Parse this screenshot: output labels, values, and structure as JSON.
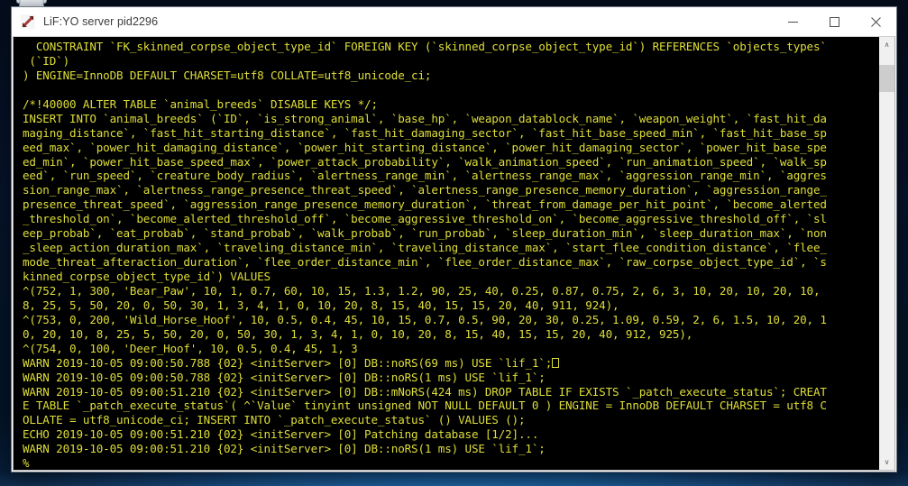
{
  "window": {
    "title": "LiF:YO server pid2296",
    "app_icon": "lif-yo-server-icon",
    "minimize_label": "Minimize",
    "maximize_label": "Maximize",
    "close_label": "Close"
  },
  "scrollbar": {
    "up_arrow": "∧",
    "down_arrow": "∨"
  },
  "console": {
    "prompt": "%",
    "lines": [
      "  CONSTRAINT `FK_skinned_corpse_object_type_id` FOREIGN KEY (`skinned_corpse_object_type_id`) REFERENCES `objects_types`",
      " (`ID`)",
      ") ENGINE=InnoDB DEFAULT CHARSET=utf8 COLLATE=utf8_unicode_ci;",
      "",
      "/*!40000 ALTER TABLE `animal_breeds` DISABLE KEYS */;",
      "INSERT INTO `animal_breeds` (`ID`, `is_strong_animal`, `base_hp`, `weapon_datablock_name`, `weapon_weight`, `fast_hit_da",
      "maging_distance`, `fast_hit_starting_distance`, `fast_hit_damaging_sector`, `fast_hit_base_speed_min`, `fast_hit_base_sp",
      "eed_max`, `power_hit_damaging_distance`, `power_hit_starting_distance`, `power_hit_damaging_sector`, `power_hit_base_spe",
      "ed_min`, `power_hit_base_speed_max`, `power_attack_probability`, `walk_animation_speed`, `run_animation_speed`, `walk_sp",
      "eed`, `run_speed`, `creature_body_radius`, `alertness_range_min`, `alertness_range_max`, `aggression_range_min`, `aggres",
      "sion_range_max`, `alertness_range_presence_threat_speed`, `alertness_range_presence_memory_duration`, `aggression_range_",
      "presence_threat_speed`, `aggression_range_presence_memory_duration`, `threat_from_damage_per_hit_point`, `become_alerted",
      "_threshold_on`, `become_alerted_threshold_off`, `become_aggressive_threshold_on`, `become_aggressive_threshold_off`, `sl",
      "eep_probab`, `eat_probab`, `stand_probab`, `walk_probab`, `run_probab`, `sleep_duration_min`, `sleep_duration_max`, `non",
      "_sleep_action_duration_max`, `traveling_distance_min`, `traveling_distance_max`, `start_flee_condition_distance`, `flee_",
      "mode_threat_afteraction_duration`, `flee_order_distance_min`, `flee_order_distance_max`, `raw_corpse_object_type_id`, `s",
      "kinned_corpse_object_type_id`) VALUES",
      "^(752, 1, 300, 'Bear_Paw', 10, 1, 0.7, 60, 10, 15, 1.3, 1.2, 90, 25, 40, 0.25, 0.87, 0.75, 2, 6, 3, 10, 20, 10, 20, 10,",
      "8, 25, 5, 50, 20, 0, 50, 30, 1, 3, 4, 1, 0, 10, 20, 8, 15, 40, 15, 15, 20, 40, 911, 924),",
      "^(753, 0, 200, 'Wild_Horse_Hoof', 10, 0.5, 0.4, 45, 10, 15, 0.7, 0.5, 90, 20, 30, 0.25, 1.09, 0.59, 2, 6, 1.5, 10, 20, 1",
      "0, 20, 10, 8, 25, 5, 50, 20, 0, 50, 30, 1, 3, 4, 1, 0, 10, 20, 8, 15, 40, 15, 15, 20, 40, 912, 925),",
      "^(754, 0, 100, 'Deer_Hoof', 10, 0.5, 0.4, 45, 1, 3",
      "WARN 2019-10-05 09:00:50.788 {02} <initServer> [0] DB::noRS(69 ms) USE `lif_1`;",
      "WARN 2019-10-05 09:00:50.788 {02} <initServer> [0] DB::noRS(1 ms) USE `lif_1`;",
      "WARN 2019-10-05 09:00:51.210 {02} <initServer> [0] DB::mNoRS(424 ms) DROP TABLE IF EXISTS `_patch_execute_status`; CREAT",
      "E TABLE `_patch_execute_status`( ^`Value` tinyint unsigned NOT NULL DEFAULT 0 ) ENGINE = InnoDB DEFAULT CHARSET = utf8 C",
      "OLLATE = utf8_unicode_ci; INSERT INTO `_patch_execute_status` () VALUES ();",
      "ECHO 2019-10-05 09:00:51.210 {02} <initServer> [0] Patching database [1/2]...",
      "WARN 2019-10-05 09:00:51.210 {02} <initServer> [0] DB::noRS(1 ms) USE `lif_1`;"
    ],
    "caret_line_index": 22,
    "colors": {
      "background": "#000000",
      "text": "#dede3a"
    }
  },
  "desktop": {
    "recycle_bin_label": "recycle-bin"
  }
}
